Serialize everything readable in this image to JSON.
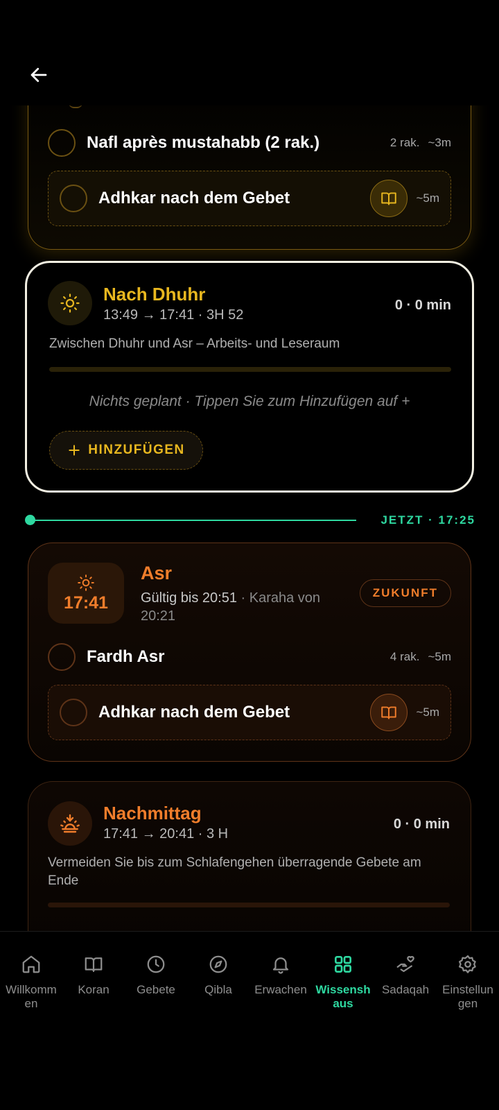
{
  "colors": {
    "gold": "#e8b71f",
    "orange": "#f07d2b",
    "green": "#2ed8a0"
  },
  "header": {
    "back_icon": "arrow-left-icon"
  },
  "card_morning": {
    "rows": [
      {
        "title": "Nafl après mustahabb (2 rak.)",
        "rak": "2 rak.",
        "duration": "~3m"
      },
      {
        "title": "Adhkar nach dem Gebet",
        "duration": "~5m",
        "icon": "book-icon"
      }
    ]
  },
  "nach_dhuhr": {
    "icon": "sun-icon",
    "title": "Nach Dhuhr",
    "time": "13:49 → 17:41 · 3H 52",
    "count": "0 · 0 min",
    "description": "Zwischen Dhuhr und Asr – Arbeits- und Leseraum",
    "empty_text": "Nichts geplant · Tippen Sie zum Hinzufügen auf +",
    "add_label": "HINZUFÜGEN",
    "progress": 0
  },
  "now_line": {
    "label": "JETZT · 17:25"
  },
  "asr": {
    "icon": "sun-icon",
    "time": "17:41",
    "title": "Asr",
    "valid": "Gültig bis 20:51",
    "karaha": " · Karaha von 20:21",
    "badge": "ZUKUNFT",
    "rows": [
      {
        "title": "Fardh Asr",
        "rak": "4 rak.",
        "duration": "~5m"
      },
      {
        "title": "Adhkar nach dem Gebet",
        "duration": "~5m",
        "icon": "book-icon"
      }
    ]
  },
  "nachmittag": {
    "icon": "sunset-icon",
    "title": "Nachmittag",
    "time": "17:41 → 20:41 · 3 H",
    "count": "0 · 0 min",
    "description": "Vermeiden Sie bis zum Schlafengehen überragende Gebete am Ende",
    "progress": 0
  },
  "nav": [
    {
      "label": "Willkommen",
      "icon": "home-icon",
      "active": false
    },
    {
      "label": "Koran",
      "icon": "book-icon",
      "active": false
    },
    {
      "label": "Gebete",
      "icon": "clock-icon",
      "active": false
    },
    {
      "label": "Qibla",
      "icon": "compass-icon",
      "active": false
    },
    {
      "label": "Erwachen",
      "icon": "bell-icon",
      "active": false
    },
    {
      "label": "Wissenshaus",
      "icon": "grid-icon",
      "active": true
    },
    {
      "label": "Sadaqah",
      "icon": "hand-heart-icon",
      "active": false
    },
    {
      "label": "Einstellungen",
      "icon": "gear-icon",
      "active": false
    }
  ]
}
